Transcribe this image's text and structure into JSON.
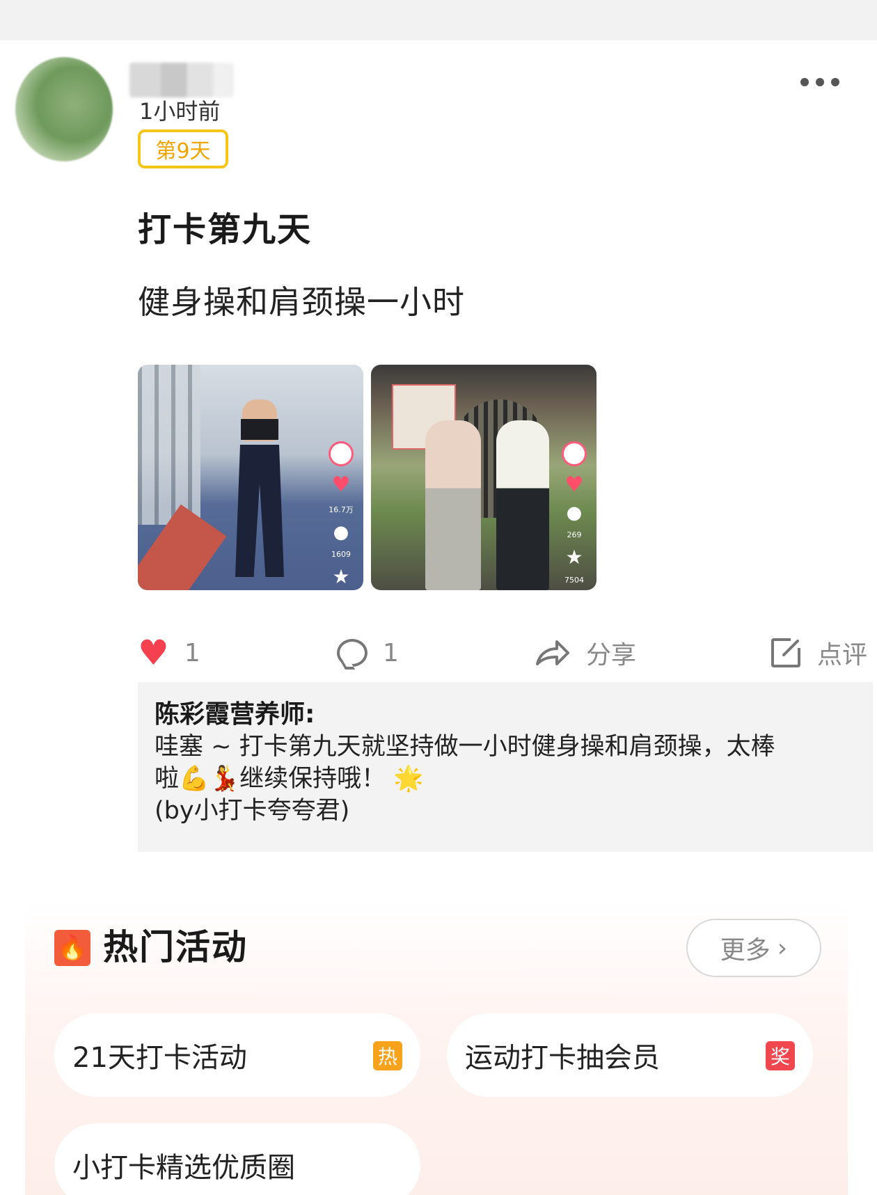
{
  "post": {
    "time_ago": "1小时前",
    "day_badge": "第9天",
    "title": "打卡第九天",
    "body": "健身操和肩颈操一小时"
  },
  "thumbnails": [
    {
      "likes": "16.7万",
      "comments": "1609"
    },
    {
      "comments": "269",
      "stars": "7504"
    }
  ],
  "actions": {
    "like_count": "1",
    "comment_count": "1",
    "share_label": "分享",
    "review_label": "点评"
  },
  "comment": {
    "author": "陈彩霞营养师:",
    "line1": "哇塞 ~ 打卡第九天就坚持做一小时健身操和肩颈操，太棒",
    "line2": "啦💪💃继续保持哦！ 🌟",
    "line3": "(by小打卡夸夸君)"
  },
  "hot": {
    "title": "热门活动",
    "more_label": "更多",
    "items": [
      {
        "label": "21天打卡活动",
        "tag": "热",
        "tag_color": "#f7a21b"
      },
      {
        "label": "运动打卡抽会员",
        "tag": "奖",
        "tag_color": "#f0474f"
      },
      {
        "label": "小打卡精选优质圈"
      }
    ]
  },
  "colors": {
    "like": "#f5404f",
    "badge_border": "#f5c518",
    "hot_icon": "#f25c3a"
  }
}
